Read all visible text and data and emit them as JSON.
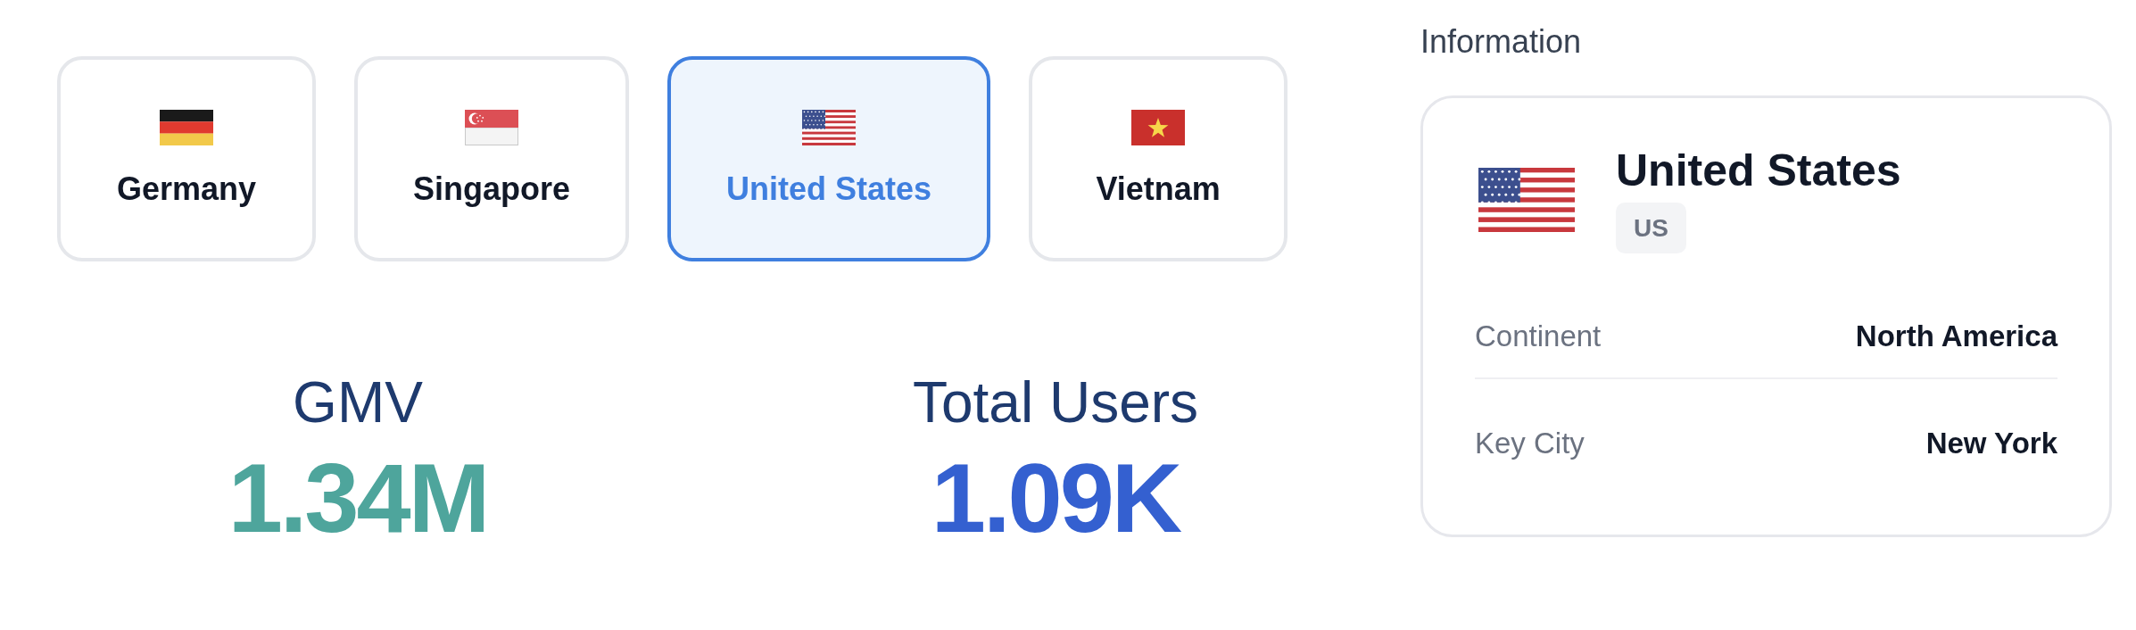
{
  "countries": [
    {
      "name": "Germany",
      "kind": "de",
      "selected": false
    },
    {
      "name": "Singapore",
      "kind": "sg",
      "selected": false
    },
    {
      "name": "United States",
      "kind": "us",
      "selected": true
    },
    {
      "name": "Vietnam",
      "kind": "vn",
      "selected": false
    }
  ],
  "metrics": [
    {
      "label": "GMV",
      "value": "1.34M",
      "color": "#4ea59c"
    },
    {
      "label": "Total Users",
      "value": "1.09K",
      "color": "#3460d0"
    }
  ],
  "information": {
    "heading": "Information",
    "kind": "us",
    "name": "United States",
    "code": "US",
    "rows": [
      {
        "label": "Continent",
        "value": "North America"
      },
      {
        "label": "Key City",
        "value": "New York"
      }
    ]
  }
}
